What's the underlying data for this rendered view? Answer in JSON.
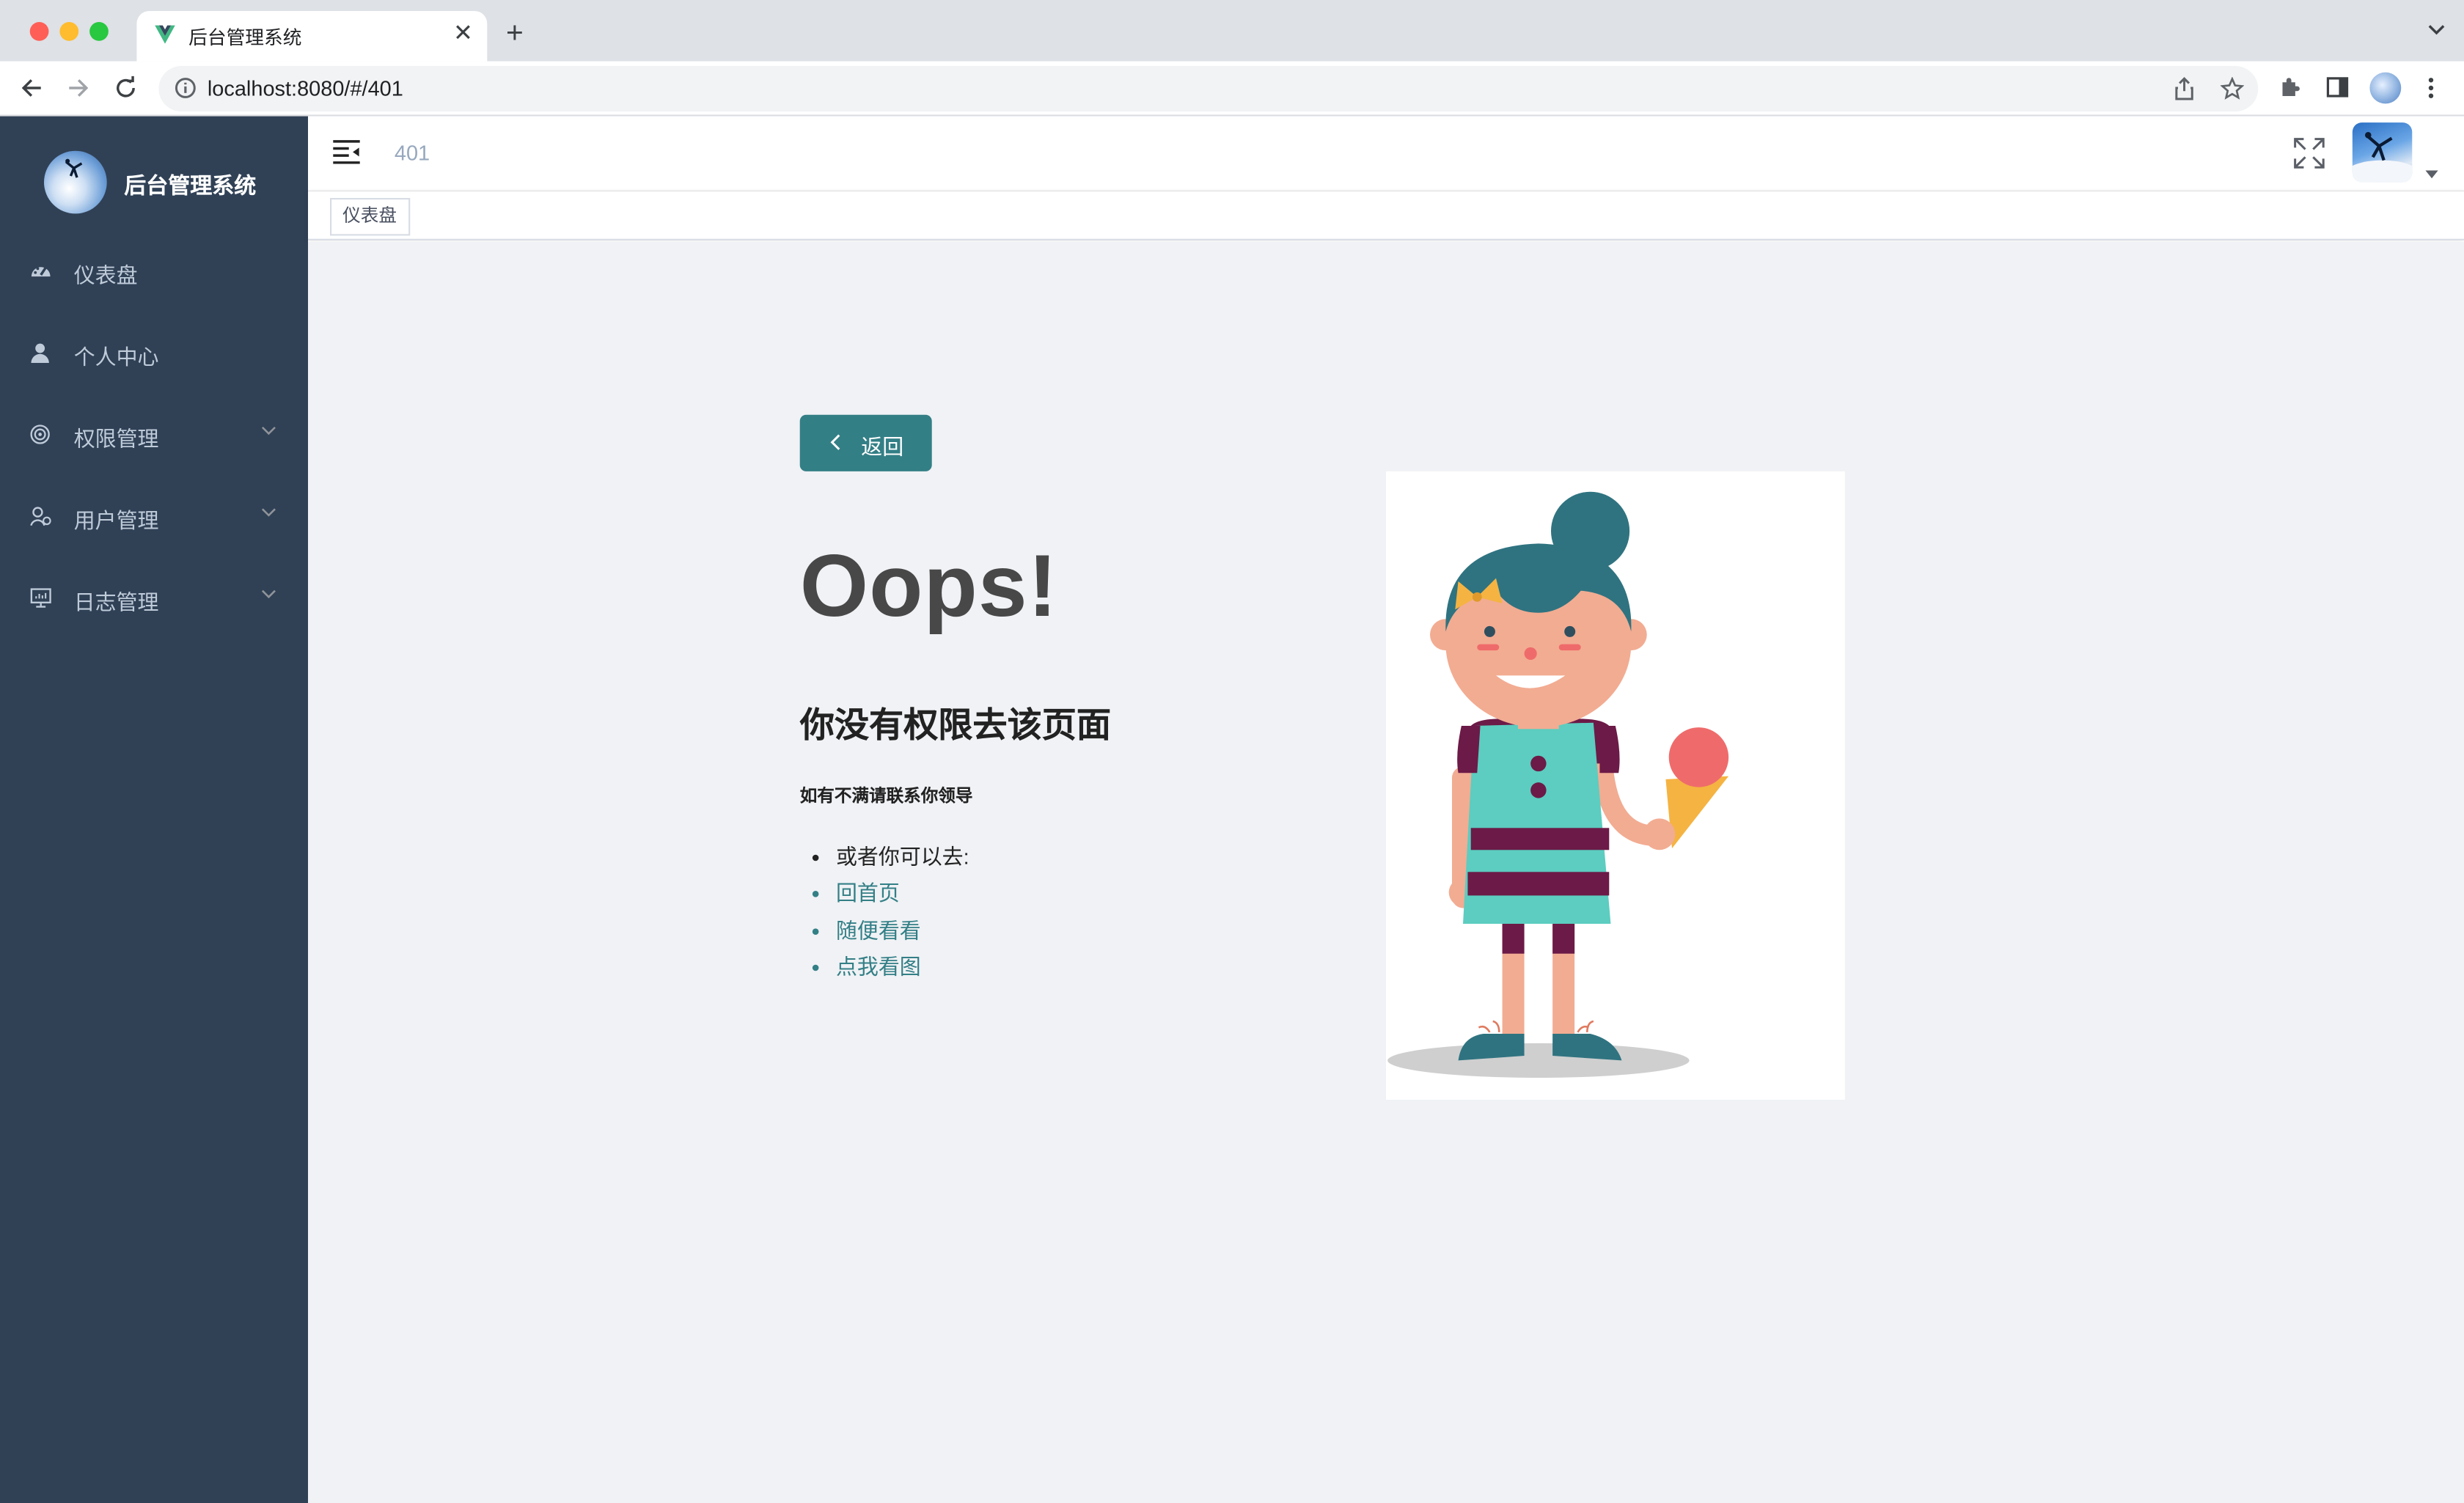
{
  "browser": {
    "tab_title": "后台管理系统",
    "url": "localhost:8080/#/401"
  },
  "sidebar": {
    "title": "后台管理系统",
    "items": [
      {
        "label": "仪表盘"
      },
      {
        "label": "个人中心"
      },
      {
        "label": "权限管理"
      },
      {
        "label": "用户管理"
      },
      {
        "label": "日志管理"
      }
    ]
  },
  "header": {
    "breadcrumb": "401"
  },
  "tags": {
    "items": [
      "仪表盘"
    ]
  },
  "page": {
    "back_label": "返回",
    "headline": "Oops!",
    "subtitle": "你没有权限去该页面",
    "note": "如有不满请联系你领导",
    "links": [
      {
        "label": "或者你可以去:",
        "is_link": false
      },
      {
        "label": "回首页",
        "is_link": true
      },
      {
        "label": "随便看看",
        "is_link": true
      },
      {
        "label": "点我看图",
        "is_link": true
      }
    ]
  },
  "colors": {
    "sidebar_bg": "#304156",
    "sidebar_text": "#bfcbd9",
    "accent": "#337f86",
    "main_bg": "#f0f2f5"
  }
}
